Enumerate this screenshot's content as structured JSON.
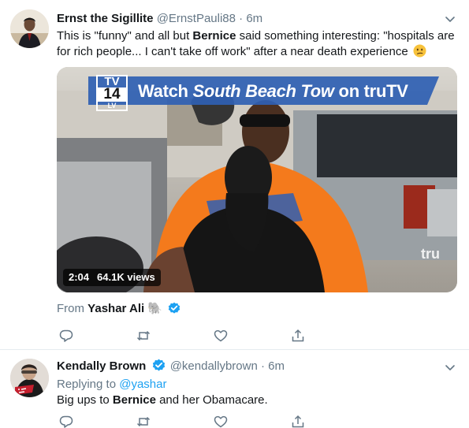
{
  "tweets": [
    {
      "author_name": "Ernst the Sigillite",
      "handle": "@ErnstPauli88",
      "separator": "·",
      "time": "6m",
      "text_parts": {
        "t1": "This is \"funny\" and all but ",
        "b1": "Bernice",
        "t2": " said something interesting: \"hospitals are for rich people... I can't take off work\" after a near death experience "
      },
      "video": {
        "rating_top": "TV",
        "rating_mid": "14",
        "rating_bottom": "LV",
        "banner_prefix": "Watch ",
        "banner_show": "South Beach Tow",
        "banner_suffix": " on truTV",
        "watermark": "tru",
        "duration": "2:04",
        "views": "64.1K views"
      },
      "from_label": "From",
      "from_name": "Yashar Ali",
      "from_emoji": "🐘"
    },
    {
      "author_name": "Kendally Brown",
      "handle": "@kendallybrown",
      "separator": "·",
      "time": "6m",
      "replying_label": "Replying to",
      "replying_to": "@yashar",
      "text_parts": {
        "t1": "Big ups to ",
        "b1": "Bernice",
        "t2": " and her Obamacare."
      }
    }
  ],
  "colors": {
    "verified": "#1da1f2",
    "secondary_text": "#657786",
    "link": "#1da1f2",
    "banner_blue": "#2f5fb3",
    "shirt_orange": "#f47a1c"
  },
  "icons": {
    "reply": "reply-icon",
    "retweet": "retweet-icon",
    "like": "heart-icon",
    "share": "share-icon",
    "caret": "chevron-down-icon",
    "verified": "verified-badge-icon"
  }
}
